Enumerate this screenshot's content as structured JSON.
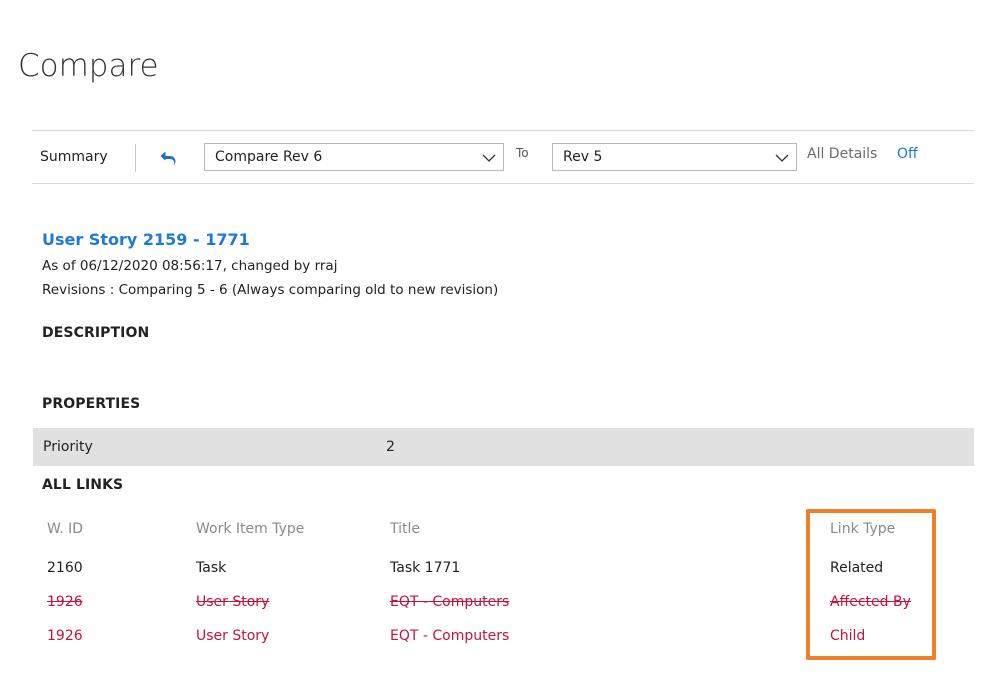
{
  "page": {
    "title": "Compare"
  },
  "toolbar": {
    "summary_label": "Summary",
    "compare_select_value": "Compare Rev 6",
    "to_label": "To",
    "to_select_value": "Rev 5",
    "all_details_label": "All Details",
    "all_details_value": "Off",
    "accent_color": "#1e7ad6"
  },
  "work_item": {
    "title": "User Story 2159 - 1771",
    "as_of": "As of 06/12/2020 08:56:17, changed by rraj",
    "revisions": "Revisions : Comparing 5 - 6 (Always comparing old to new revision)"
  },
  "sections": {
    "description": "DESCRIPTION",
    "properties": "PROPERTIES",
    "all_links": "ALL LINKS"
  },
  "properties": [
    {
      "name": "Priority",
      "value": "2"
    }
  ],
  "links": {
    "headers": {
      "wid": "W. ID",
      "type": "Work Item Type",
      "title": "Title",
      "link_type": "Link Type"
    },
    "rows": [
      {
        "wid": "2160",
        "type": "Task",
        "title": "Task 1771",
        "link_type": "Related",
        "status": "unchanged"
      },
      {
        "wid": "1926",
        "type": "User Story",
        "title": "EQT - Computers",
        "link_type": "Affected By",
        "status": "removed"
      },
      {
        "wid": "1926",
        "type": "User Story",
        "title": "EQT - Computers",
        "link_type": "Child",
        "status": "added"
      }
    ],
    "change_color": "#c4123a",
    "highlight_color": "#f08028"
  }
}
